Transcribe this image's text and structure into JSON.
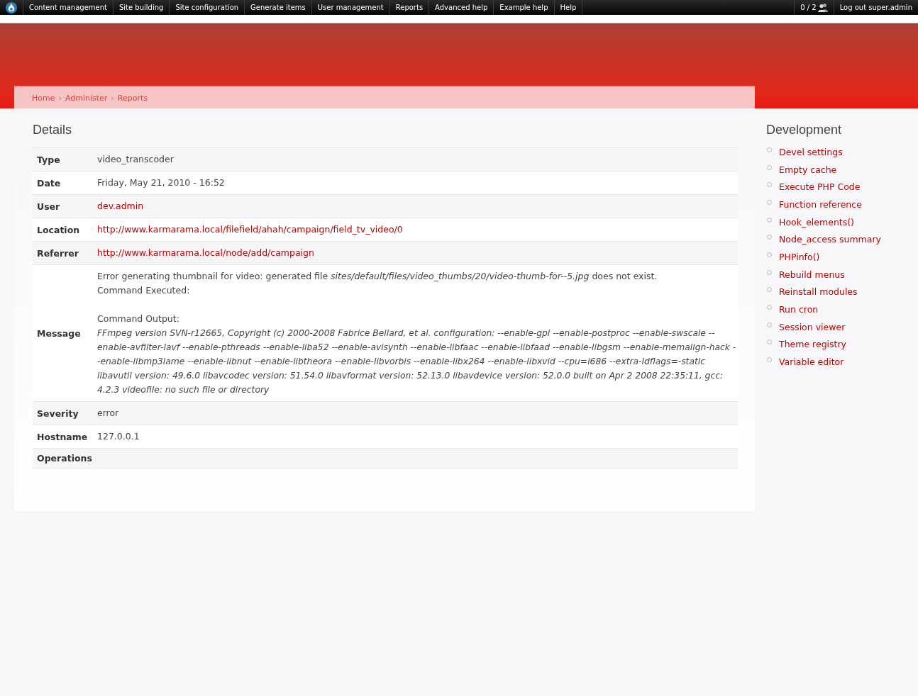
{
  "toolbar": {
    "items": [
      "Content management",
      "Site building",
      "Site configuration",
      "Generate items",
      "User management",
      "Reports",
      "Advanced help",
      "Example help",
      "Help"
    ],
    "users_count": "0 / 2",
    "logout": "Log out super.admin"
  },
  "breadcrumb": [
    "Home",
    "Administer",
    "Reports"
  ],
  "breadcrumb_separator": "›",
  "title": "Details",
  "details": [
    {
      "label": "Type",
      "kind": "text",
      "value": "video_transcoder"
    },
    {
      "label": "Date",
      "kind": "text",
      "value": "Friday, May 21, 2010 - 16:52"
    },
    {
      "label": "User",
      "kind": "link",
      "value": "dev.admin"
    },
    {
      "label": "Location",
      "kind": "link",
      "value": "http://www.karmarama.local/filefield/ahah/campaign/field_tv_video/0"
    },
    {
      "label": "Referrer",
      "kind": "link",
      "value": "http://www.karmarama.local/node/add/campaign"
    },
    {
      "label": "Message",
      "kind": "message",
      "blocks": [
        {
          "kind": "note",
          "lines": [
            "Error generating thumbnail for video: generated file *sites/default/files/video_thumbs/20/video-thumb-for--5.jpg* does not exist.",
            "Command Executed:"
          ]
        },
        {
          "kind": "note",
          "lines": [
            "Command Output:"
          ]
        },
        {
          "kind": "output",
          "lines": [
            "FFmpeg version SVN-r12665, Copyright (c) 2000-2008 Fabrice Bellard, et al. configuration: --enable-gpl --enable-postproc --enable-swscale --enable-avfilter-lavf --enable-pthreads --enable-liba52 --enable-avisynth --enable-libfaac --enable-libfaad --enable-libgsm --enable-memalign-hack --enable-libmp3lame --enable-libnut --enable-libtheora --enable-libvorbis --enable-libx264 --enable-libxvid --cpu=i686 --extra-ldflags=-static libavutil version: 49.6.0 libavcodec version: 51.54.0 libavformat version: 52.13.0 libavdevice version: 52.0.0 built on Apr 2 2008 22:35:11, gcc: 4.2.3 videofile: no such file or directory"
          ]
        }
      ]
    },
    {
      "label": "Severity",
      "kind": "text",
      "value": "error"
    },
    {
      "label": "Hostname",
      "kind": "text",
      "value": "127.0.0.1"
    },
    {
      "label": "Operations",
      "kind": "text"
    }
  ],
  "sidebar": {
    "title": "Development",
    "items": [
      "Devel settings",
      "Empty cache",
      "Execute PHP Code",
      "Function reference",
      "Hook_elements()",
      "Node_access summary",
      "PHPinfo()",
      "Rebuild menus",
      "Reinstall modules",
      "Run cron",
      "Session viewer",
      "Theme registry",
      "Variable editor"
    ]
  }
}
